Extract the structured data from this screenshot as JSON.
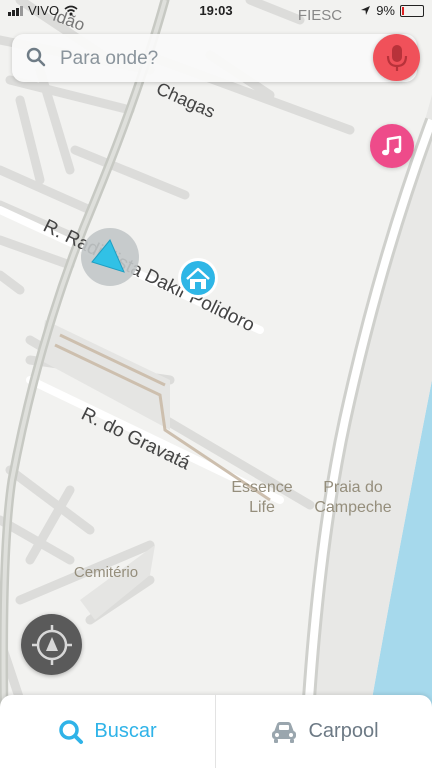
{
  "status_bar": {
    "carrier": "VIVO",
    "time": "19:03",
    "battery": "9%",
    "background_place": "FIESC"
  },
  "search": {
    "placeholder": "Para onde?"
  },
  "map": {
    "labels": {
      "street_1": "R. Radialista Dakir Polidoro",
      "street_2": "R. do Gravatá",
      "street_top": "Chagas",
      "street_top_left": "idão",
      "poi_1_line1": "Essence",
      "poi_1_line2": "Life",
      "poi_2_line1": "Praia do",
      "poi_2_line2": "Campeche",
      "poi_3": "Cemitério"
    }
  },
  "bottom_bar": {
    "search_label": "Buscar",
    "carpool_label": "Carpool"
  },
  "colors": {
    "accent_blue": "#2fb3e8",
    "mic_red": "#f0515a",
    "music_pink": "#ee4b8a",
    "water": "#a6d9ec"
  },
  "icons": {
    "search": "search-icon",
    "mic": "microphone-icon",
    "music": "music-note-icon",
    "home": "home-icon",
    "recenter": "recenter-icon",
    "carpool": "car-icon"
  }
}
